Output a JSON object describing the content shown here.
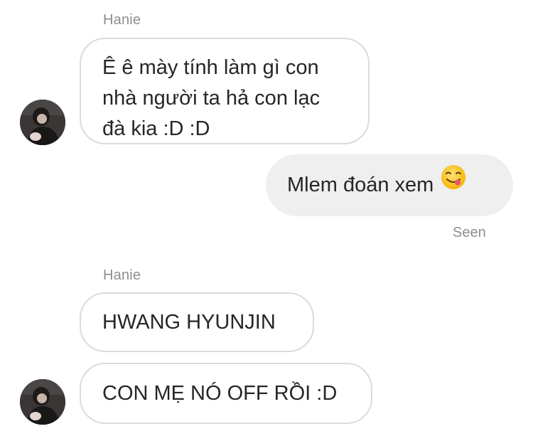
{
  "conversation": {
    "messages": [
      {
        "sender": "Hanie",
        "lines": [
          "Ê ê mày tính làm gì con",
          "nhà người ta hả con lạc",
          "đà kia :D :D"
        ]
      },
      {
        "sender": "me",
        "text": "Mlem đoán xem",
        "emoji": "yum-face-emoji",
        "status": "Seen"
      },
      {
        "sender": "Hanie",
        "text": "HWANG HYUNJIN"
      },
      {
        "sender": "Hanie",
        "text": "CON MẸ NÓ OFF RỒI :D"
      }
    ]
  },
  "colors": {
    "incoming_border": "#dbdbdb",
    "outgoing_bg": "#efefef",
    "meta_text": "#8e8e8e",
    "message_text": "#262626"
  }
}
